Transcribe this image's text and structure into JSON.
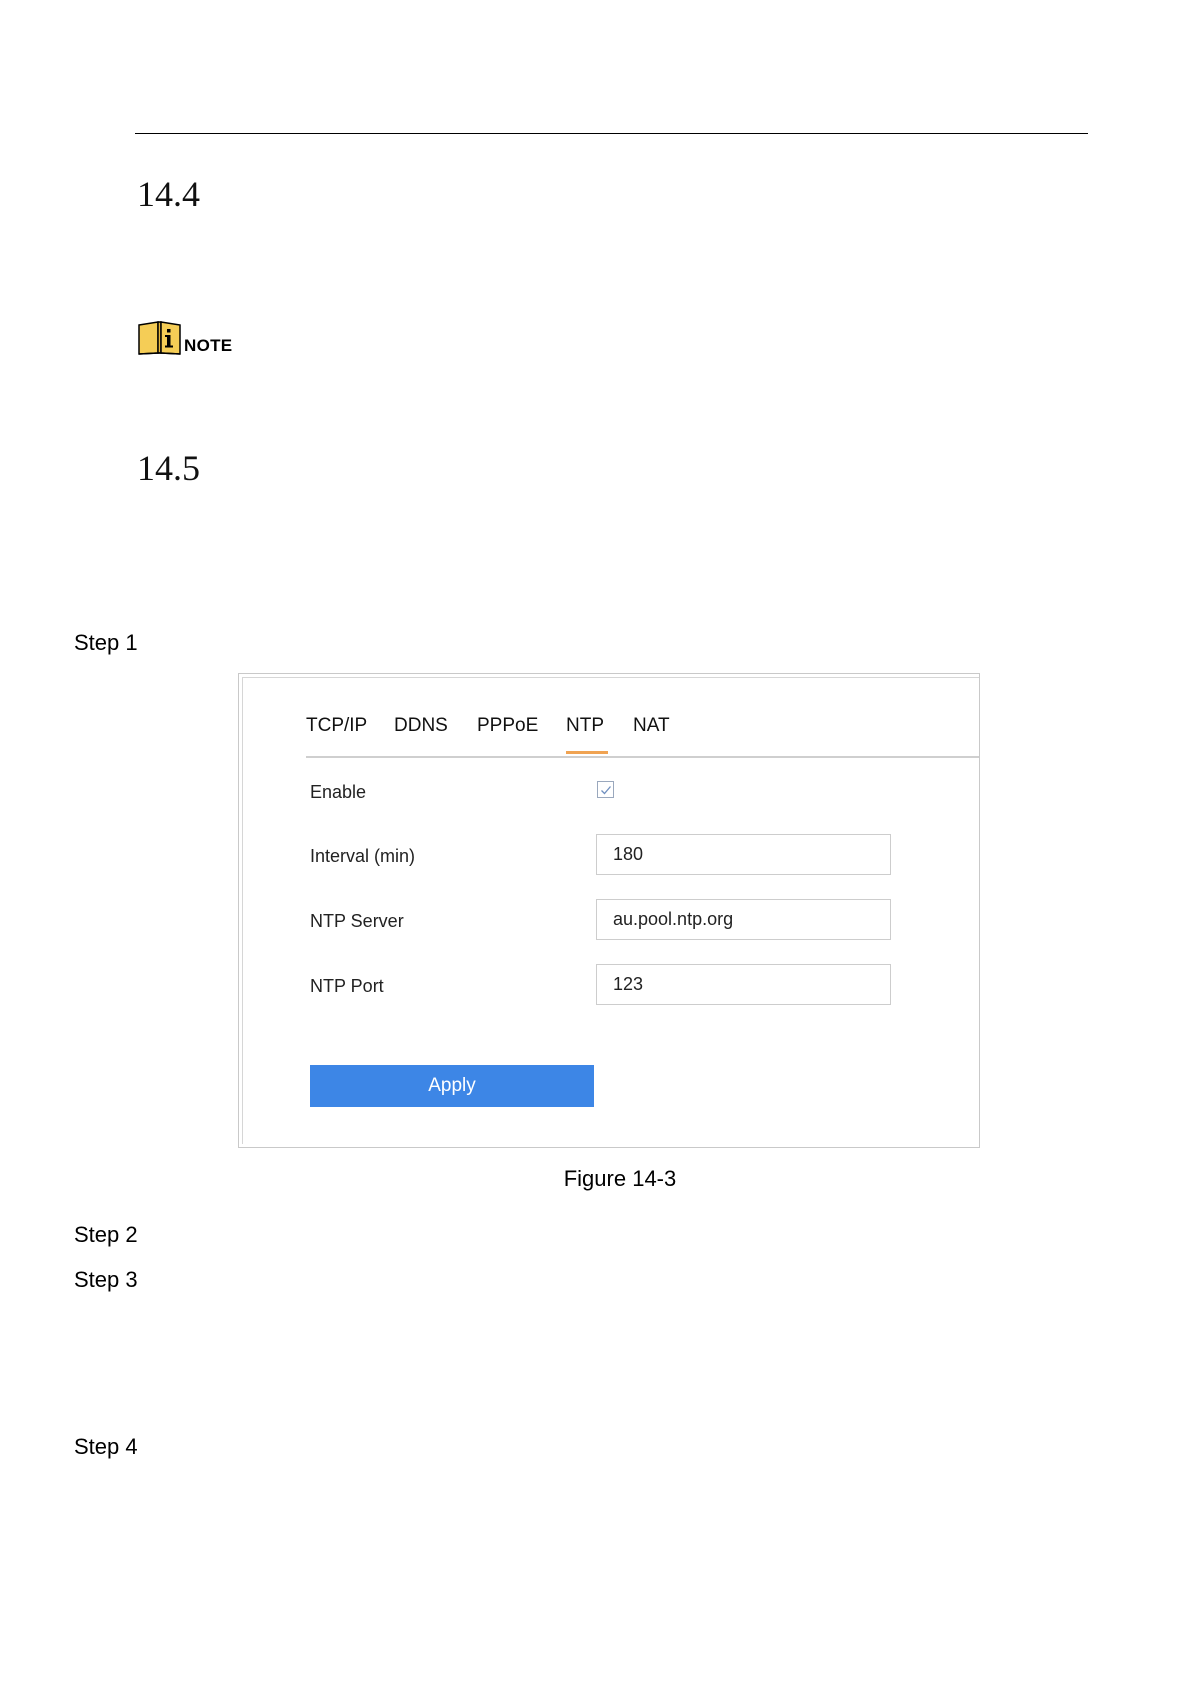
{
  "sections": [
    {
      "number": "14.4"
    },
    {
      "number": "14.5"
    }
  ],
  "note": {
    "label": "NOTE"
  },
  "steps": [
    "Step 1",
    "Step 2",
    "Step 3",
    "Step 4"
  ],
  "figure": {
    "tabs": [
      {
        "label": "TCP/IP",
        "active": false
      },
      {
        "label": "DDNS",
        "active": false
      },
      {
        "label": "PPPoE",
        "active": false
      },
      {
        "label": "NTP",
        "active": true
      },
      {
        "label": "NAT",
        "active": false
      }
    ],
    "form": {
      "enable_label": "Enable",
      "enable_checked": true,
      "interval_label": "Interval (min)",
      "interval_value": "180",
      "server_label": "NTP Server",
      "server_value": "au.pool.ntp.org",
      "port_label": "NTP Port",
      "port_value": "123"
    },
    "apply_label": "Apply",
    "caption": "Figure 14-3"
  },
  "colors": {
    "accent": "#3d86e6",
    "tab_underline": "#f0a352",
    "note_icon": "#f5cd56"
  }
}
